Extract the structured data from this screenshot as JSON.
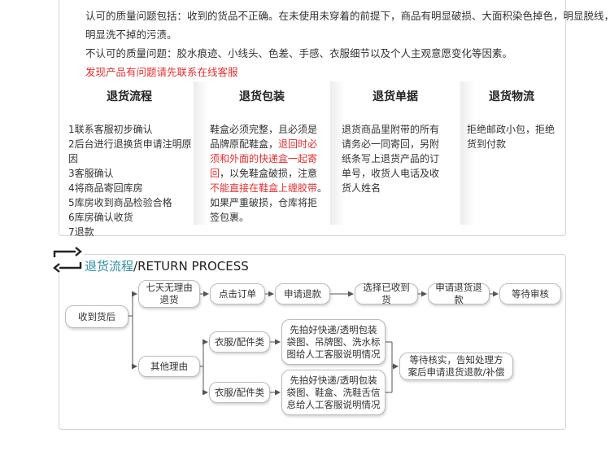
{
  "policy": {
    "line1": "认可的质量问题包括：收到的货品不正确。在未使用未穿着的前提下，商品有明显破损、大面积染色掉色，明显脱线，",
    "line2": "明显洗不掉的污渍。",
    "line3": "不认可的质量问题：胶水痕迹、小线头、色差、手感、衣服细节以及个人主观意愿变化等因素。",
    "line4": "发现产品有问题请先联系在线客服"
  },
  "columns": [
    {
      "title": "退货流程",
      "lines": [
        "1联系客服初步确认",
        "2后台进行退换货申请注明原因",
        "3客服确认",
        "4将商品寄回库房",
        "5库房收到商品检验合格",
        "6库房确认收货",
        "7退款"
      ]
    },
    {
      "title": "退货包装",
      "l1": "鞋盒必须完整，且必须是",
      "l2a": "品牌原配鞋盒，",
      "l2b": "退回时必",
      "l3": "须和外面的快递盒一起寄",
      "l4a": "回",
      "l4b": "，以免鞋盒破损，注意",
      "l5a": "不能直接在鞋盒上缠胶带",
      "l5b": "。",
      "l6": "如果严重破损，仓库将拒",
      "l7": "签包裹。"
    },
    {
      "title": "退货单据",
      "lines": [
        "退货商品里附带的所有",
        "请务必一同寄回，另附",
        "纸条写上退货产品的订",
        "单号，收货人电话及收",
        "货人姓名"
      ]
    },
    {
      "title": "退货物流",
      "lines": [
        "拒绝邮政小包，拒绝",
        "货到付款"
      ]
    }
  ],
  "process": {
    "title_cn": "退货流程",
    "title_en": "/RETURN PROCESS",
    "receive": "收到货后",
    "seven_day_1": "七天无理由",
    "seven_day_2": "退货",
    "click_order": "点击订单",
    "apply_refund": "申请退款",
    "select_received": "选择已收到货",
    "apply_return_refund": "申请退货退款",
    "wait_review": "等待审核",
    "other_reason": "其他理由",
    "clothes": "衣服/配件类",
    "shoes": "衣服/配件类",
    "clothes_note": [
      "先拍好快递/透明包装",
      "袋图、吊牌图、洗水标",
      "图给人工客服说明情况"
    ],
    "shoes_note": [
      "先拍好快递/透明包装",
      "袋图、鞋盒、洗鞋舌信",
      "息给人工客服说明情况"
    ],
    "verify": [
      "等待核实，告知处理方",
      "案后申请退货退款/补偿"
    ]
  }
}
